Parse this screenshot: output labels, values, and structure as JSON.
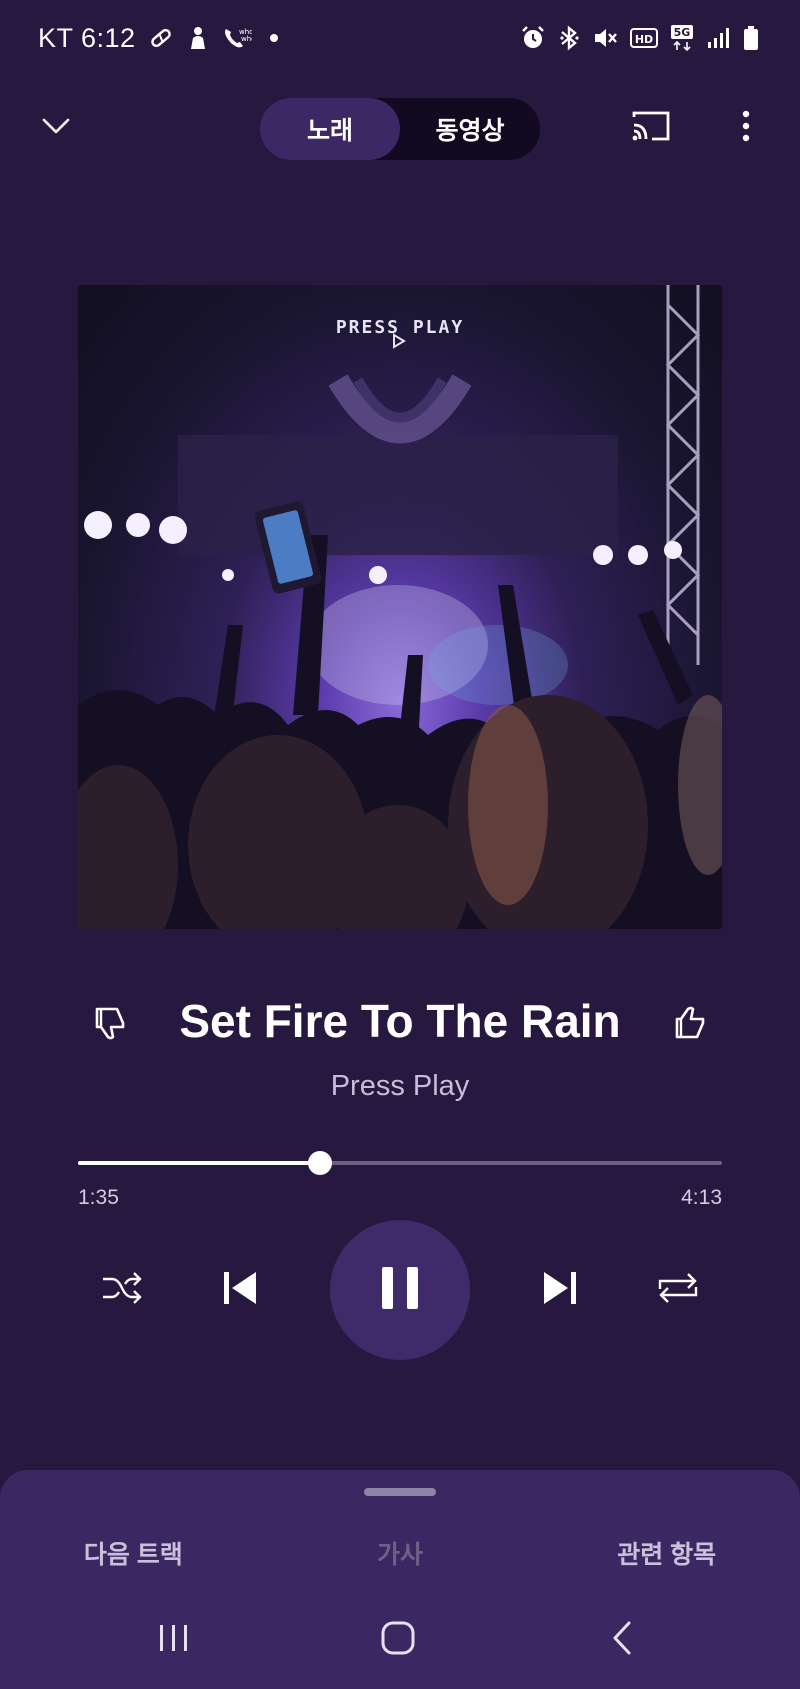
{
  "status_bar": {
    "carrier_time": "KT 6:12",
    "notification_icons": [
      "pill-icon",
      "person-icon",
      "whowho-call-icon",
      "dot-icon"
    ],
    "system_icons": [
      "alarm-icon",
      "bluetooth-icon",
      "mute-icon",
      "hd-icon",
      "5g-icon",
      "signal-icon",
      "battery-icon"
    ],
    "hd_label": "HD",
    "network_label": "5G"
  },
  "header": {
    "collapse_icon": "chevron-down-icon",
    "tabs": [
      {
        "label": "노래",
        "active": true
      },
      {
        "label": "동영상",
        "active": false
      }
    ],
    "cast_icon": "cast-icon",
    "more_icon": "more-vert-icon"
  },
  "album_art": {
    "caption": "PRESS PLAY"
  },
  "track": {
    "title": "Set Fire To The Rain",
    "artist": "Press Play",
    "dislike_icon": "thumbs-down-icon",
    "like_icon": "thumbs-up-icon"
  },
  "progress": {
    "elapsed": "1:35",
    "total": "4:13",
    "fraction": 0.375
  },
  "controls": {
    "shuffle_icon": "shuffle-icon",
    "prev_icon": "skip-previous-icon",
    "play_pause_icon": "pause-icon",
    "next_icon": "skip-next-icon",
    "repeat_icon": "repeat-icon"
  },
  "bottom_sheet": {
    "tabs": [
      {
        "label": "다음 트랙",
        "enabled": true
      },
      {
        "label": "가사",
        "enabled": false
      },
      {
        "label": "관련 항목",
        "enabled": true
      }
    ]
  },
  "nav_bar": {
    "icons": [
      "recents-icon",
      "home-icon",
      "back-icon"
    ]
  },
  "colors": {
    "background": "#26183f",
    "accent": "#3f2b69",
    "sheet": "#3b2862"
  }
}
